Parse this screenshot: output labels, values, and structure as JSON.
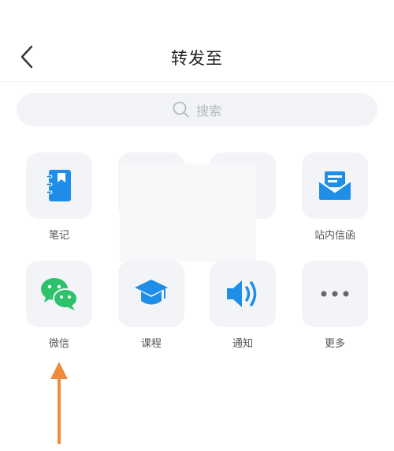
{
  "header": {
    "title": "转发至"
  },
  "search": {
    "placeholder": "搜索"
  },
  "grid": [
    {
      "label": "笔记",
      "icon": "notebook-icon",
      "color": "#1f8ee8"
    },
    {
      "label": "",
      "icon": "",
      "color": ""
    },
    {
      "label": "",
      "icon": "",
      "color": ""
    },
    {
      "label": "站内信函",
      "icon": "mail-icon",
      "color": "#1f8ee8"
    },
    {
      "label": "微信",
      "icon": "wechat-icon",
      "color": "#2dc16b"
    },
    {
      "label": "课程",
      "icon": "graduation-cap-icon",
      "color": "#1f8ee8"
    },
    {
      "label": "通知",
      "icon": "speaker-icon",
      "color": "#1f8ee8"
    },
    {
      "label": "更多",
      "icon": "more-dots-icon",
      "color": "#666666"
    }
  ],
  "colors": {
    "accent": "#1f8ee8",
    "wechat": "#2dc16b",
    "annotation_arrow": "#f08a3c"
  }
}
